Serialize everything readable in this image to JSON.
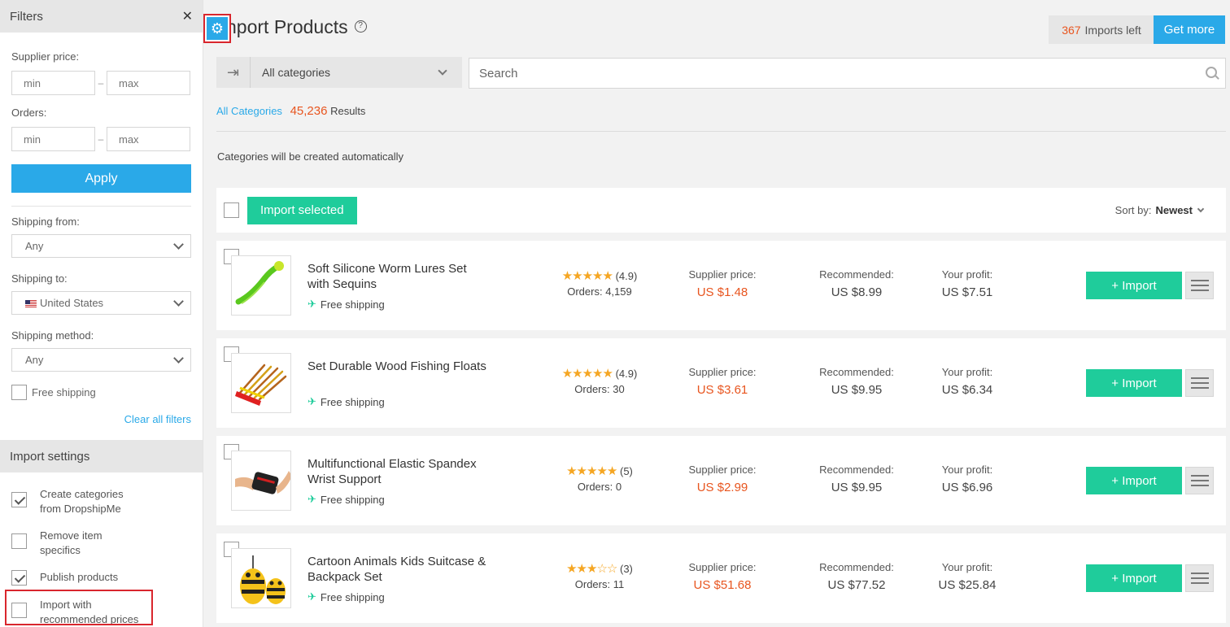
{
  "filters": {
    "title": "Filters",
    "supplier_price_label": "Supplier price:",
    "orders_label": "Orders:",
    "min_placeholder": "min",
    "max_placeholder": "max",
    "apply_label": "Apply",
    "shipping_from_label": "Shipping from:",
    "shipping_from_value": "Any",
    "shipping_to_label": "Shipping to:",
    "shipping_to_value": "United States",
    "shipping_method_label": "Shipping method:",
    "shipping_method_value": "Any",
    "free_shipping_label": "Free shipping",
    "clear_all_label": "Clear all filters"
  },
  "import_settings": {
    "title": "Import settings",
    "items": [
      {
        "label_line1": "Create categories",
        "label_line2": "from DropshipMe",
        "checked": true
      },
      {
        "label_line1": "Remove item",
        "label_line2": "specifics",
        "checked": false
      },
      {
        "label_line1": "Publish products",
        "label_line2": "",
        "checked": true
      },
      {
        "label_line1": "Import with",
        "label_line2": "recommended prices",
        "checked": false
      }
    ]
  },
  "header": {
    "title": "nport Products",
    "help_glyph": "?",
    "imports_left_count": "367",
    "imports_left_label": "Imports left",
    "get_more_label": "Get more"
  },
  "toolbar": {
    "category": "All categories",
    "search_placeholder": "Search"
  },
  "results": {
    "breadcrumb": "All Categories",
    "count": "45,236",
    "label": "Results"
  },
  "auto_note": "Categories will be created automatically",
  "bulk": {
    "import_selected_label": "Import selected",
    "sort_label": "Sort by:",
    "sort_value": "Newest"
  },
  "labels": {
    "free_shipping": "Free shipping",
    "supplier_price": "Supplier price:",
    "recommended": "Recommended:",
    "your_profit": "Your profit:",
    "orders_prefix": "Orders:",
    "import_button": "+ Import"
  },
  "products": [
    {
      "name": "Soft Silicone Worm Lures Set with Sequins",
      "stars": "★★★★★",
      "rating": "(4.9)",
      "orders": "4,159",
      "supplier_price": "US $1.48",
      "recommended": "US $8.99",
      "profit": "US $7.51"
    },
    {
      "name": "Set Durable Wood Fishing Floats",
      "stars": "★★★★★",
      "rating": "(4.9)",
      "orders": "30",
      "supplier_price": "US $3.61",
      "recommended": "US $9.95",
      "profit": "US $6.34"
    },
    {
      "name": "Multifunctional Elastic Spandex Wrist Support",
      "stars": "★★★★★",
      "rating": "(5)",
      "orders": "0",
      "supplier_price": "US $2.99",
      "recommended": "US $9.95",
      "profit": "US $6.96"
    },
    {
      "name": "Cartoon Animals Kids Suitcase & Backpack Set",
      "stars": "★★★☆☆",
      "rating": "(3)",
      "orders": "11",
      "supplier_price": "US $51.68",
      "recommended": "US $77.52",
      "profit": "US $25.84"
    }
  ],
  "colors": {
    "accent_blue": "#2aa9e8",
    "import_green": "#1fcc9b",
    "price_red": "#e8551f",
    "highlight_red": "#d9262d"
  }
}
